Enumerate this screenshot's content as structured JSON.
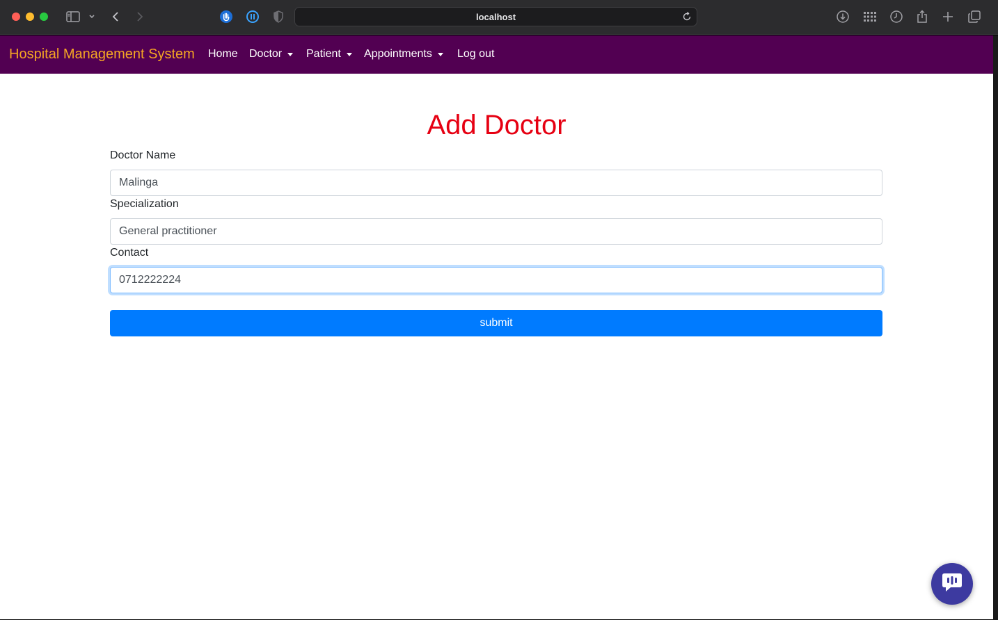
{
  "browser": {
    "url": "localhost"
  },
  "navbar": {
    "brand": "Hospital Management System",
    "brand_color": "#f5a623",
    "background": "#520052",
    "items": [
      {
        "label": "Home",
        "dropdown": false
      },
      {
        "label": "Doctor",
        "dropdown": true
      },
      {
        "label": "Patient",
        "dropdown": true
      },
      {
        "label": "Appointments",
        "dropdown": true
      },
      {
        "label": "Log out",
        "dropdown": false
      }
    ]
  },
  "form": {
    "title": "Add Doctor",
    "title_color": "#e60012",
    "fields": [
      {
        "label": "Doctor Name",
        "value": "Malinga"
      },
      {
        "label": "Specialization",
        "value": "General practitioner"
      },
      {
        "label": "Contact",
        "value": "0712222224"
      }
    ],
    "focused_field": "Contact",
    "submit_label": "submit",
    "submit_color": "#007bff"
  },
  "icons": {
    "sidebar": "sidebar-icon",
    "back": "chevron-left-icon",
    "forward": "chevron-right-icon",
    "reload": "reload-icon",
    "downloads": "download-icon",
    "chat": "chat-icon"
  }
}
